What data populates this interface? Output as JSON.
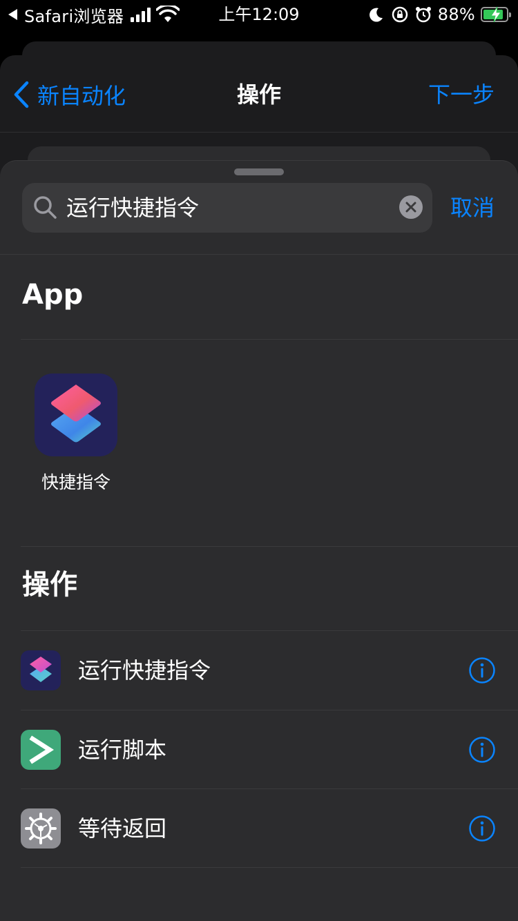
{
  "status_bar": {
    "back_app": "Safari浏览器",
    "time": "上午12:09",
    "battery_percent": "88%",
    "signal_bars": 4,
    "icons": [
      "back-arrow-icon",
      "signal-icon",
      "wifi-icon",
      "moon-icon",
      "orientation-lock-icon",
      "alarm-icon",
      "battery-charging-icon"
    ]
  },
  "nav": {
    "back_label": "新自动化",
    "title": "操作",
    "next_label": "下一步"
  },
  "search": {
    "query": "运行快捷指令",
    "cancel_label": "取消"
  },
  "apps_section": {
    "title": "App",
    "apps": [
      {
        "label": "快捷指令",
        "icon": "shortcuts-app-icon"
      }
    ]
  },
  "actions_section": {
    "title": "操作",
    "items": [
      {
        "label": "运行快捷指令",
        "icon": "shortcuts-icon"
      },
      {
        "label": "运行脚本",
        "icon": "script-icon"
      },
      {
        "label": "等待返回",
        "icon": "gear-icon"
      }
    ]
  },
  "colors": {
    "accent": "#0a84ff",
    "sheet_bg": "#2c2c2e",
    "background": "#000000",
    "script_green": "#3fa87a"
  }
}
